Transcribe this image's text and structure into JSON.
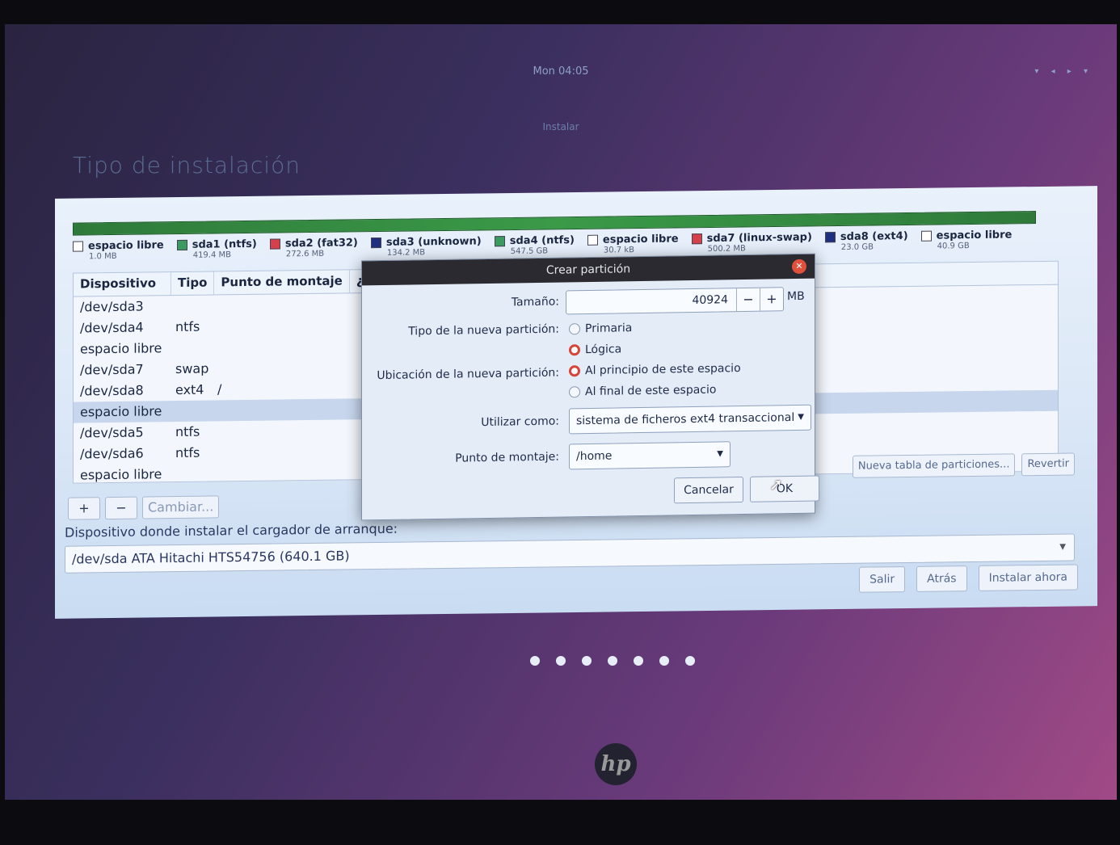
{
  "topbar": {
    "clock": "Mon 04:05"
  },
  "window": {
    "title": "Instalar",
    "page_title": "Tipo de instalación"
  },
  "legend": [
    {
      "name": "espacio libre",
      "size": "1.0 MB",
      "color": "#ffffff"
    },
    {
      "name": "sda1 (ntfs)",
      "size": "419.4 MB",
      "color": "#3a9a60"
    },
    {
      "name": "sda2 (fat32)",
      "size": "272.6 MB",
      "color": "#d6404a"
    },
    {
      "name": "sda3 (unknown)",
      "size": "134.2 MB",
      "color": "#1f2f80"
    },
    {
      "name": "sda4 (ntfs)",
      "size": "547.5 GB",
      "color": "#3a9a60"
    },
    {
      "name": "espacio libre",
      "size": "30.7 kB",
      "color": "#ffffff"
    },
    {
      "name": "sda7 (linux-swap)",
      "size": "500.2 MB",
      "color": "#d6404a"
    },
    {
      "name": "sda8 (ext4)",
      "size": "23.0 GB",
      "color": "#1f2f80"
    },
    {
      "name": "espacio libre",
      "size": "40.9 GB",
      "color": "#ffffff"
    }
  ],
  "table": {
    "headers": [
      "Dispositivo",
      "Tipo",
      "Punto de montaje",
      "¿Fo"
    ],
    "rows": [
      {
        "device": "/dev/sda3",
        "type": "",
        "mount": ""
      },
      {
        "device": "/dev/sda4",
        "type": "ntfs",
        "mount": ""
      },
      {
        "device": "espacio libre",
        "type": "",
        "mount": ""
      },
      {
        "device": "/dev/sda7",
        "type": "swap",
        "mount": ""
      },
      {
        "device": "/dev/sda8",
        "type": "ext4",
        "mount": "/"
      },
      {
        "device": "espacio libre",
        "type": "",
        "mount": ""
      },
      {
        "device": "/dev/sda5",
        "type": "ntfs",
        "mount": ""
      },
      {
        "device": "/dev/sda6",
        "type": "ntfs",
        "mount": ""
      },
      {
        "device": "espacio libre",
        "type": "",
        "mount": ""
      }
    ]
  },
  "buttons": {
    "add": "+",
    "remove": "−",
    "change": "Cambiar...",
    "new_table": "Nueva tabla de particiones...",
    "revert": "Revertir",
    "quit": "Salir",
    "back": "Atrás",
    "install": "Instalar ahora"
  },
  "bootloader": {
    "label": "Dispositivo donde instalar el cargador de arranque:",
    "value": "/dev/sda   ATA Hitachi HTS54756 (640.1 GB)"
  },
  "dialog": {
    "title": "Crear partición",
    "size_label": "Tamaño:",
    "size_value": "40924",
    "size_unit": "MB",
    "minus": "−",
    "plus": "+",
    "type_label": "Tipo de la nueva partición:",
    "type_primary": "Primaria",
    "type_logical": "Lógica",
    "location_label": "Ubicación de la nueva partición:",
    "location_start": "Al principio de este espacio",
    "location_end": "Al final de este espacio",
    "use_as_label": "Utilizar como:",
    "use_as_value": "sistema de ficheros ext4 transaccional",
    "mount_label": "Punto de montaje:",
    "mount_value": "/home",
    "cancel": "Cancelar",
    "ok": "OK"
  },
  "brand": "hp"
}
